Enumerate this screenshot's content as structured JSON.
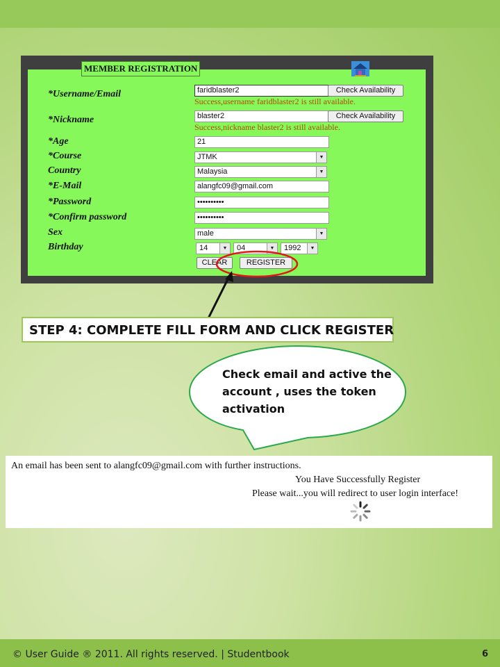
{
  "form": {
    "title": "MEMBER REGISTRATION",
    "fields": {
      "username": {
        "label": "*Username/Email",
        "value": "faridblaster2",
        "check_label": "Check Availability",
        "success": "Success,username faridblaster2 is still available."
      },
      "nickname": {
        "label": "*Nickname",
        "value": "blaster2",
        "check_label": "Check Availability",
        "success": "Success,nickname blaster2 is still available."
      },
      "age": {
        "label": "*Age",
        "value": "21"
      },
      "course": {
        "label": "*Course",
        "value": "JTMK"
      },
      "country": {
        "label": "Country",
        "value": "Malaysia"
      },
      "email": {
        "label": "*E-Mail",
        "value": "alangfc09@gmail.com"
      },
      "password": {
        "label": "*Password",
        "value": "••••••••••"
      },
      "confirm_password": {
        "label": "*Confirm password",
        "value": "••••••••••"
      },
      "sex": {
        "label": "Sex",
        "value": "male"
      },
      "birthday": {
        "label": "Birthday",
        "day": "14",
        "month": "04",
        "year": "1992"
      }
    },
    "buttons": {
      "clear": "CLEAR",
      "register": "REGISTER"
    }
  },
  "step_caption": "STEP 4: COMPLETE FILL FORM AND CLICK REGISTER",
  "callout": {
    "line1": "Check email and active the",
    "line2": "account , uses the token",
    "line3": "activation"
  },
  "result": {
    "email_sent": "An email has been sent to alangfc09@gmail.com with further instructions.",
    "success": "You Have Successfully Register",
    "redirect": "Please wait...you will redirect to user login interface!"
  },
  "footer": {
    "text": "© User Guide ® 2011. All rights reserved. | Studentbook",
    "page": "6"
  },
  "colors": {
    "form_bg": "#86f85a",
    "frame": "#3f3f3f",
    "success_text": "#b0490d",
    "highlight": "#e01818",
    "band": "#97c95a"
  }
}
